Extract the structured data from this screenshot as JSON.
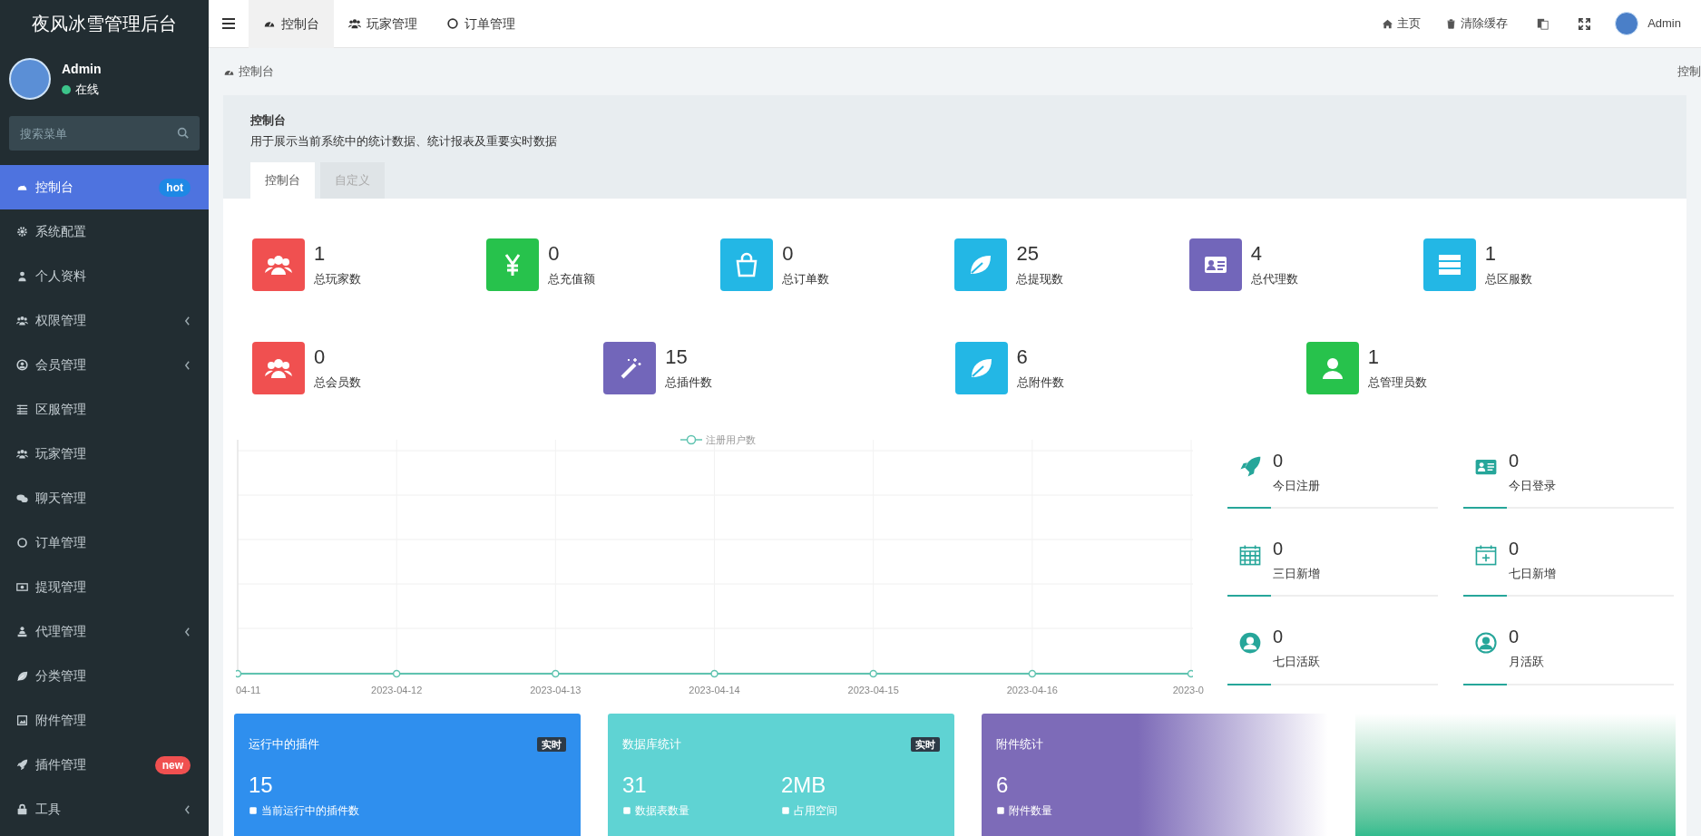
{
  "sidebar": {
    "title": "夜风冰雪管理后台",
    "user": {
      "name": "Admin",
      "status": "在线",
      "online": true
    },
    "search": {
      "placeholder": "搜索菜单"
    },
    "items": [
      {
        "label": "控制台",
        "selected": true,
        "has_children": false,
        "badge": {
          "text": "hot",
          "color": "#1e88e5"
        }
      },
      {
        "label": "系统配置",
        "selected": false,
        "has_children": false
      },
      {
        "label": "个人资料",
        "selected": false,
        "has_children": false
      },
      {
        "label": "权限管理",
        "selected": false,
        "has_children": true
      },
      {
        "label": "会员管理",
        "selected": false,
        "has_children": true
      },
      {
        "label": "区服管理",
        "selected": false,
        "has_children": false
      },
      {
        "label": "玩家管理",
        "selected": false,
        "has_children": false
      },
      {
        "label": "聊天管理",
        "selected": false,
        "has_children": false
      },
      {
        "label": "订单管理",
        "selected": false,
        "has_children": false
      },
      {
        "label": "提现管理",
        "selected": false,
        "has_children": false
      },
      {
        "label": "代理管理",
        "selected": false,
        "has_children": true
      },
      {
        "label": "分类管理",
        "selected": false,
        "has_children": false
      },
      {
        "label": "附件管理",
        "selected": false,
        "has_children": false
      },
      {
        "label": "插件管理",
        "selected": false,
        "has_children": false,
        "badge": {
          "text": "new",
          "color": "#f05050"
        }
      },
      {
        "label": "工具",
        "selected": false,
        "has_children": true
      }
    ]
  },
  "topbar": {
    "tabs": [
      {
        "label": "控制台",
        "selected": true
      },
      {
        "label": "玩家管理",
        "selected": false
      },
      {
        "label": "订单管理",
        "selected": false
      }
    ],
    "links": [
      "主页",
      "清除缓存"
    ],
    "user": "Admin"
  },
  "breadcrumb": {
    "left": "控制台",
    "right": "控制"
  },
  "header": {
    "title": "控制台",
    "description": "用于展示当前系统中的统计数据、统计报表及重要实时数据",
    "tabs": [
      {
        "label": "控制台",
        "selected": true
      },
      {
        "label": "自定义",
        "selected": false
      }
    ]
  },
  "stats_row_1": [
    {
      "value": "1",
      "label": "总玩家数",
      "color": "#f05050"
    },
    {
      "value": "0",
      "label": "总充值额",
      "color": "#27c24c"
    },
    {
      "value": "0",
      "label": "总订单数",
      "color": "#23b7e5"
    },
    {
      "value": "25",
      "label": "总提现数",
      "color": "#23b7e5"
    },
    {
      "value": "4",
      "label": "总代理数",
      "color": "#7266ba"
    },
    {
      "value": "1",
      "label": "总区服数",
      "color": "#23b7e5"
    }
  ],
  "stats_row_2": [
    {
      "value": "0",
      "label": "总会员数",
      "color": "#f05050"
    },
    {
      "value": "15",
      "label": "总插件数",
      "color": "#7266ba"
    },
    {
      "value": "6",
      "label": "总附件数",
      "color": "#23b7e5"
    },
    {
      "value": "1",
      "label": "总管理员数",
      "color": "#27c24c"
    }
  ],
  "chart": {
    "legend": "注册用户数",
    "x_labels": [
      "04-11",
      "2023-04-12",
      "2023-04-13",
      "2023-04-14",
      "2023-04-15",
      "2023-04-16",
      "2023-0"
    ]
  },
  "activity": [
    {
      "value": "0",
      "label": "今日注册"
    },
    {
      "value": "0",
      "label": "今日登录"
    },
    {
      "value": "0",
      "label": "三日新增"
    },
    {
      "value": "0",
      "label": "七日新增"
    },
    {
      "value": "0",
      "label": "七日活跃"
    },
    {
      "value": "0",
      "label": "月活跃"
    }
  ],
  "cards": [
    {
      "title": "运行中的插件",
      "badge": "实时",
      "color": "#2f8fee",
      "metrics": [
        {
          "value": "15",
          "label": "当前运行中的插件数"
        }
      ]
    },
    {
      "title": "数据库统计",
      "badge": "实时",
      "color": "#5fd3d3",
      "metrics": [
        {
          "value": "31",
          "label": "数据表数量"
        },
        {
          "value": "2MB",
          "label": "占用空间"
        }
      ]
    },
    {
      "title": "附件统计",
      "color": "#7d6bb8",
      "metrics": [
        {
          "value": "6",
          "label": "附件数量"
        }
      ]
    }
  ]
}
